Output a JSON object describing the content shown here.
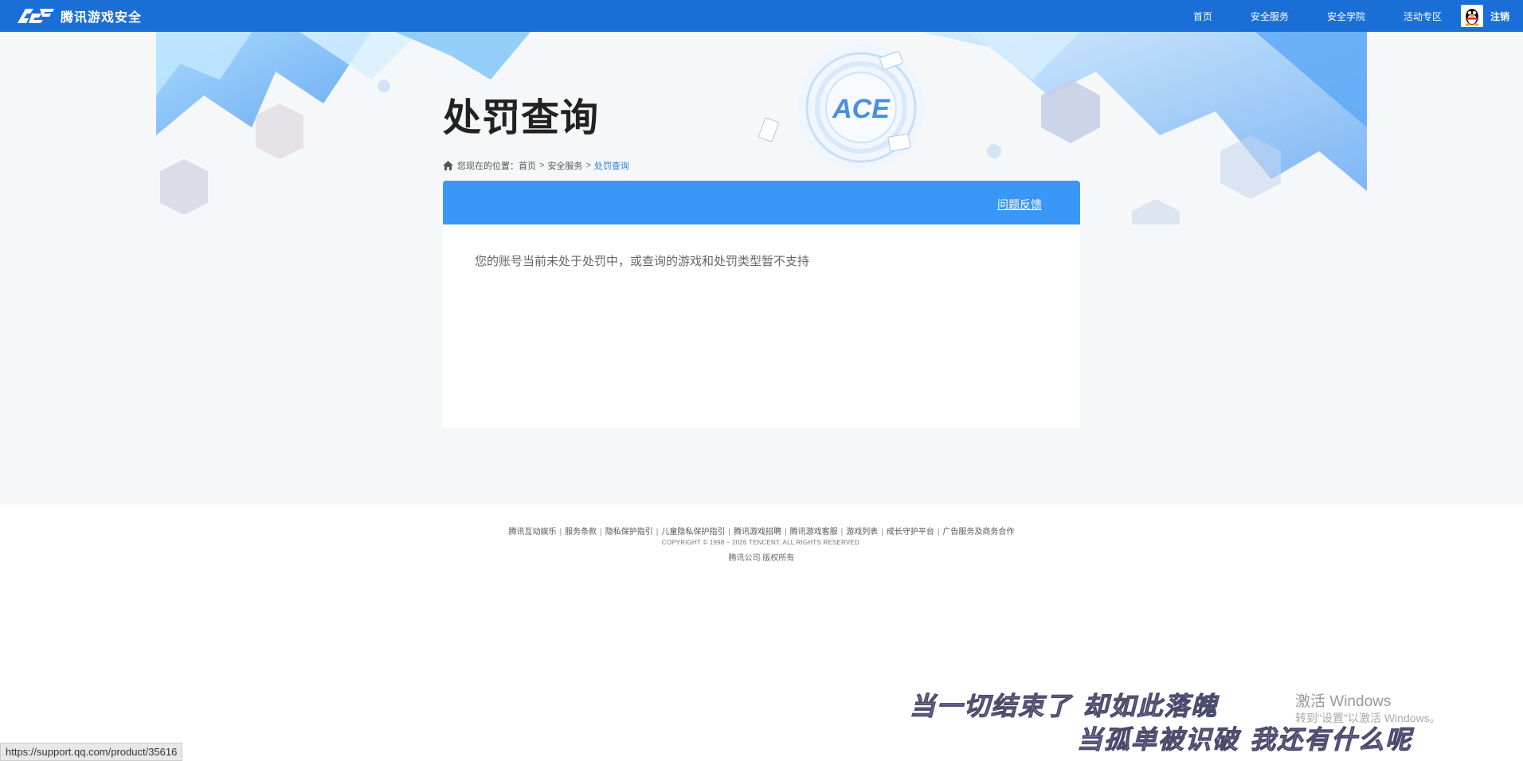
{
  "colors": {
    "nav": "#1a6fd6",
    "panel_head": "#3a97f5",
    "crumb_current": "#2c7fd8",
    "page_bg": "#f6f7f8"
  },
  "header": {
    "logo_text": "腾讯游戏安全",
    "nav": [
      "首页",
      "安全服务",
      "安全学院",
      "活动专区"
    ],
    "user": "注销"
  },
  "page": {
    "title": "处罚查询",
    "breadcrumb": {
      "prefix": "您现在的位置：",
      "items": [
        "首页",
        "安全服务"
      ],
      "current": "处罚查询"
    }
  },
  "panel": {
    "feedback": "问题反馈",
    "message": "您的账号当前未处于处罚中，或查询的游戏和处罚类型暂不支持"
  },
  "footer": {
    "links": [
      "腾讯互动娱乐",
      "服务条款",
      "隐私保护指引",
      "儿童隐私保护指引",
      "腾讯游戏招聘",
      "腾讯游戏客服",
      "游戏列表",
      "成长守护平台",
      "广告服务及商务合作"
    ],
    "copyright": "COPYRIGHT © 1998 – 2026 TENCENT. ALL RIGHTS RESERVED.",
    "rights": "腾讯公司 版权所有"
  },
  "overlay": {
    "status_url": "https://support.qq.com/product/35616",
    "lyric_line1": "当一切结束了 却如此落魄",
    "lyric_line2": "当孤单被识破 我还有什么呢",
    "windows_activate": "激活 Windows",
    "windows_activate_sub": "转到\"设置\"以激活 Windows。"
  }
}
